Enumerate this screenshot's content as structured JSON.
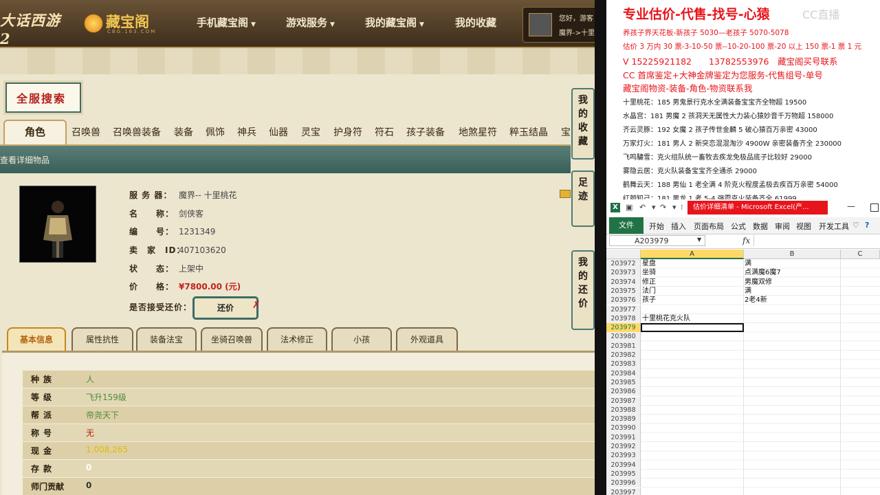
{
  "site": {
    "game_logo": "大话西游2",
    "site_logo": "藏宝阁",
    "site_logo_sub": "CBG.163.COM",
    "nav": [
      {
        "label": "手机藏宝阁"
      },
      {
        "label": "游戏服务"
      },
      {
        "label": "我的藏宝阁"
      },
      {
        "label": "我的收藏"
      }
    ],
    "user_greeting": "您好，游客",
    "user_server": "魔界->十里"
  },
  "search_title": "全服搜索",
  "categories": [
    "角色",
    "召唤兽",
    "召唤兽装备",
    "装备",
    "佩饰",
    "神兵",
    "仙器",
    "灵宝",
    "护身符",
    "符石",
    "孩子装备",
    "地煞星符",
    "粹玉结晶",
    "宝"
  ],
  "detail_bar": "查看详细物品",
  "item": {
    "server_label": "服 务 器：",
    "server": "魔界-- 十里桃花",
    "name_label": "名　　称：",
    "name": "剑侠客",
    "id_label": "编　　号：",
    "id": "1231349",
    "seller_label": "卖　家　ID：",
    "seller_id": "407103620",
    "status_label": "状　　态：",
    "status": "上架中",
    "price_label": "价　　格：",
    "price": "¥7800.00 (元)",
    "counter_label": "是否接受还价：",
    "counter_button": "还价"
  },
  "side_buttons": [
    "我的收藏",
    "足迹",
    "我的还价"
  ],
  "info_tabs": [
    "基本信息",
    "属性抗性",
    "装备法宝",
    "坐骑召唤兽",
    "法术修正",
    "小孩",
    "外观道具"
  ],
  "attributes": [
    {
      "key": "种族",
      "value": "人",
      "color": "#4e8a3a"
    },
    {
      "key": "等级",
      "value": "飞升159级",
      "color": "#4e8a3a"
    },
    {
      "key": "帮派",
      "value": "帝尧天下",
      "color": "#4e8a3a"
    },
    {
      "key": "称号",
      "value": "无",
      "color": "#b3201c"
    },
    {
      "key": "现金",
      "value": "1,008,265",
      "color": "#e6b800"
    },
    {
      "key": "存款",
      "value": "0",
      "color": "#ffffff"
    },
    {
      "key": "师门贡献",
      "value": "0",
      "color": "#333333"
    }
  ],
  "doc": {
    "headline": "专业估价-代售-找号-心猿",
    "watermark": "CC直播",
    "red_lines": [
      "养孩子界天花板-新孩子 5030—老孩子 5070-5078",
      "估价 3 万内 30 票-3-10-50 票--10-20-100 票-20 以上 150 票-1 票 1 元",
      "V 15225921182　　13782553976　藏宝阁买号联系",
      "CC 首席鉴定+大神金牌鉴定为您服务-代售组号-单号",
      "藏宝阁物资-装备-角色-物资联系我"
    ],
    "black_lines": [
      "十里桃花：185 男鬼景行克水全满装备宝宝齐全物超 19500",
      "水晶宫：181 男魔 2 孩洞天无属性大力装心猿妙音千万物超 158000",
      "齐云灵豚：192 女魔 2 孩子传世金麟 5 破心猿百万亲密 43000",
      "万家灯火：181 男人 2 新突恋混混淘沙 4900W 亲密装备齐全 230000",
      "飞鸣驌雪：克火组队统一畜牧去疾龙免极品底子比较好 29000",
      "雾隐云居：克火队装备宝宝齐全通杀 29000",
      "鹤舞云天：188 男仙 1 老全满 4 阶克火程度孟极去疾百万亲密 54000",
      "红颜知己：181 男龙 1 老 5-4 强霞克火装备齐全 61999"
    ]
  },
  "excel": {
    "icon": "X",
    "title": "估价详细清单 - Microsoft Excel(产...",
    "file_tab": "文件",
    "ribbon_tabs": [
      "开始",
      "插入",
      "页面布局",
      "公式",
      "数据",
      "审阅",
      "视图",
      "开发工具"
    ],
    "name_box": "A203979",
    "fx": "fx",
    "columns": [
      "A",
      "B",
      "C"
    ],
    "rows": [
      {
        "n": "203972",
        "a": "星盘",
        "b": "满"
      },
      {
        "n": "203973",
        "a": "坐骑",
        "b": "点满魔6魔7"
      },
      {
        "n": "203974",
        "a": "修正",
        "b": "男魔双修"
      },
      {
        "n": "203975",
        "a": "法门",
        "b": "满"
      },
      {
        "n": "203976",
        "a": "孩子",
        "b": "2老4新"
      },
      {
        "n": "203977",
        "a": "",
        "b": ""
      },
      {
        "n": "203978",
        "a": "十里桃花克火队",
        "b": ""
      },
      {
        "n": "203979",
        "a": "",
        "b": ""
      },
      {
        "n": "203980",
        "a": "",
        "b": ""
      },
      {
        "n": "203981",
        "a": "",
        "b": ""
      },
      {
        "n": "203982",
        "a": "",
        "b": ""
      },
      {
        "n": "203983",
        "a": "",
        "b": ""
      },
      {
        "n": "203984",
        "a": "",
        "b": ""
      },
      {
        "n": "203985",
        "a": "",
        "b": ""
      },
      {
        "n": "203986",
        "a": "",
        "b": ""
      },
      {
        "n": "203987",
        "a": "",
        "b": ""
      },
      {
        "n": "203988",
        "a": "",
        "b": ""
      },
      {
        "n": "203989",
        "a": "",
        "b": ""
      },
      {
        "n": "203990",
        "a": "",
        "b": ""
      },
      {
        "n": "203991",
        "a": "",
        "b": ""
      },
      {
        "n": "203992",
        "a": "",
        "b": ""
      },
      {
        "n": "203993",
        "a": "",
        "b": ""
      },
      {
        "n": "203994",
        "a": "",
        "b": ""
      },
      {
        "n": "203995",
        "a": "",
        "b": ""
      },
      {
        "n": "203996",
        "a": "",
        "b": ""
      },
      {
        "n": "203997",
        "a": "",
        "b": ""
      }
    ],
    "selected_row": "203979"
  }
}
